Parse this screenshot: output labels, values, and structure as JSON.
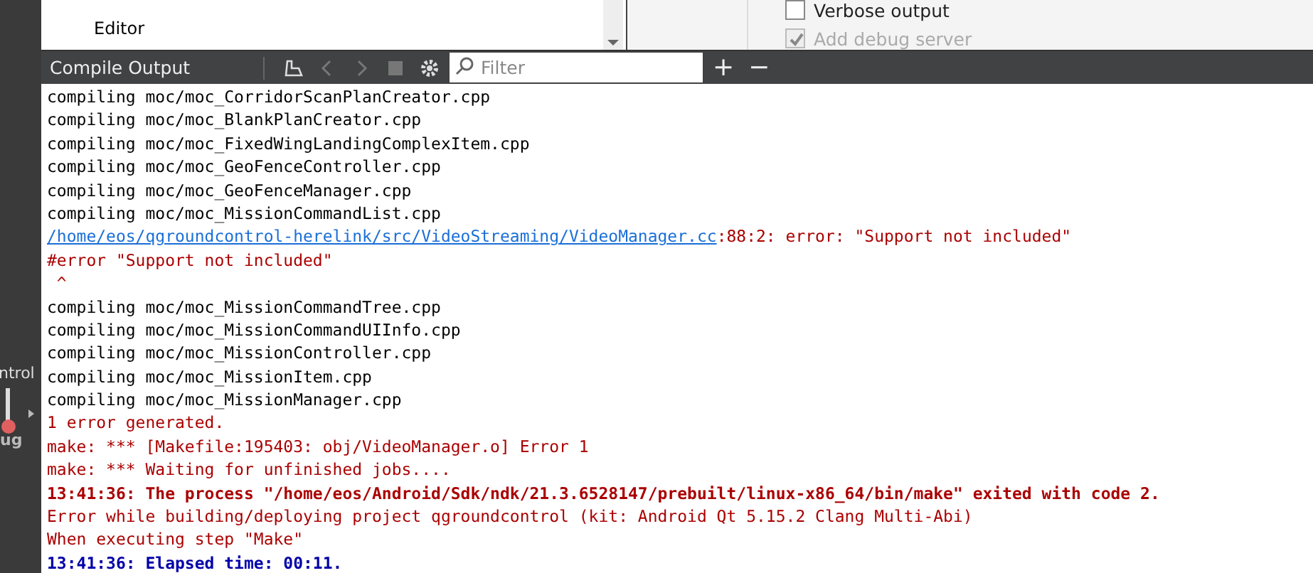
{
  "top_panel": {
    "tree_items": [
      "Editor"
    ],
    "options": [
      {
        "label": "Verbose output",
        "checked": false,
        "disabled": false
      },
      {
        "label": "Add debug server",
        "checked": true,
        "disabled": true
      }
    ]
  },
  "side_strip": {
    "labels": [
      "ntrol",
      "ug"
    ]
  },
  "output_pane": {
    "title": "Compile Output",
    "filter": {
      "placeholder": "Filter"
    },
    "buttons": [
      "+",
      "−"
    ]
  },
  "lines": [
    {
      "kind": "normal",
      "text": "compiling moc/moc_CorridorScanPlanCreator.cpp"
    },
    {
      "kind": "normal",
      "text": "compiling moc/moc_BlankPlanCreator.cpp"
    },
    {
      "kind": "normal",
      "text": "compiling moc/moc_FixedWingLandingComplexItem.cpp"
    },
    {
      "kind": "normal",
      "text": "compiling moc/moc_GeoFenceController.cpp"
    },
    {
      "kind": "normal",
      "text": "compiling moc/moc_GeoFenceManager.cpp"
    },
    {
      "kind": "normal",
      "text": "compiling moc/moc_MissionCommandList.cpp"
    },
    {
      "kind": "link",
      "link": "/home/eos/qgroundcontrol-herelink/src/VideoStreaming/VideoManager.cc",
      "text": ":88:2: error: \"Support not included\""
    },
    {
      "kind": "error",
      "text": "#error \"Support not included\""
    },
    {
      "kind": "error",
      "text": " ^"
    },
    {
      "kind": "normal",
      "text": "compiling moc/moc_MissionCommandTree.cpp"
    },
    {
      "kind": "normal",
      "text": "compiling moc/moc_MissionCommandUIInfo.cpp"
    },
    {
      "kind": "normal",
      "text": "compiling moc/moc_MissionController.cpp"
    },
    {
      "kind": "normal",
      "text": "compiling moc/moc_MissionItem.cpp"
    },
    {
      "kind": "normal",
      "text": "compiling moc/moc_MissionManager.cpp"
    },
    {
      "kind": "error",
      "text": "1 error generated."
    },
    {
      "kind": "error",
      "text": "make: *** [Makefile:195403: obj/VideoManager.o] Error 1"
    },
    {
      "kind": "error",
      "text": "make: *** Waiting for unfinished jobs...."
    },
    {
      "kind": "bold-error",
      "text": "13:41:36: The process \"/home/eos/Android/Sdk/ndk/21.3.6528147/prebuilt/linux-x86_64/bin/make\" exited with code 2."
    },
    {
      "kind": "error",
      "text": "Error while building/deploying project qgroundcontrol (kit: Android Qt 5.15.2 Clang Multi-Abi)"
    },
    {
      "kind": "error",
      "text": "When executing step \"Make\""
    },
    {
      "kind": "bold-info",
      "text": "13:41:36: Elapsed time: 00:11."
    }
  ]
}
